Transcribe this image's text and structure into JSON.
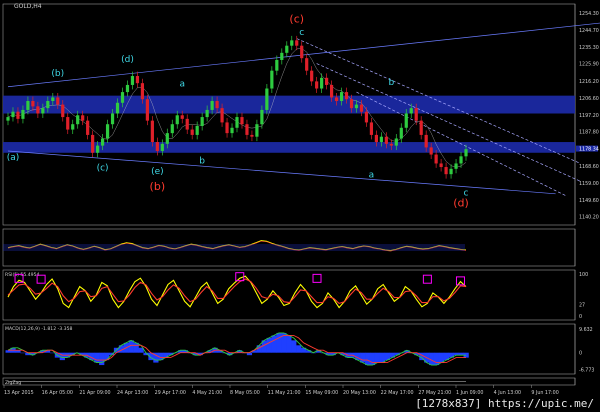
{
  "window": {
    "symbol_label": "GOLD,H4"
  },
  "footer": {
    "url": "[1278x837] https://upic.me/"
  },
  "colors": {
    "background": "#000000",
    "bull": "#2ecc40",
    "bear": "#e0202a",
    "band": "#1c2aa8",
    "rsi": "#ffff00",
    "rsi_box": "#ff00ff",
    "macd_hist": "#1f3fff",
    "wave_cyan": "#3fd8e6",
    "wave_red": "#ff3b2f",
    "wave_green": "#7dff8a",
    "grid_text": "#cfcfcf"
  },
  "chart_data": [
    {
      "type": "candlestick",
      "name_label": "GOLD,H4",
      "ylim": [
        1140,
        1256
      ],
      "y_ticks": [
        "1254.30",
        "1244.70",
        "1235.30",
        "1225.90",
        "1216.20",
        "1206.60",
        "1197.20",
        "1187.80",
        "1178.34",
        "1168.60",
        "1159.00",
        "1149.60",
        "1140.20"
      ],
      "current_price": "1178.34",
      "closes": [
        1196,
        1199,
        1195,
        1200,
        1205,
        1202,
        1198,
        1201,
        1205,
        1207,
        1203,
        1196,
        1189,
        1192,
        1197,
        1194,
        1186,
        1176,
        1180,
        1184,
        1192,
        1198,
        1204,
        1210,
        1214,
        1219,
        1215,
        1206,
        1194,
        1182,
        1177,
        1181,
        1187,
        1192,
        1197,
        1195,
        1189,
        1186,
        1191,
        1196,
        1200,
        1205,
        1201,
        1193,
        1187,
        1190,
        1196,
        1192,
        1186,
        1185,
        1192,
        1200,
        1212,
        1222,
        1228,
        1232,
        1236,
        1239,
        1236,
        1229,
        1222,
        1216,
        1212,
        1218,
        1214,
        1207,
        1205,
        1210,
        1206,
        1201,
        1203,
        1199,
        1193,
        1186,
        1182,
        1185,
        1181,
        1180,
        1184,
        1190,
        1198,
        1201,
        1194,
        1186,
        1179,
        1175,
        1170,
        1168,
        1164,
        1167,
        1170,
        1174,
        1178
      ],
      "bands": [
        [
          1198,
          1208
        ],
        [
          1176,
          1182
        ]
      ],
      "wave_labels": [
        {
          "text": "(c)",
          "color": "red",
          "i": 58,
          "price": 1249
        },
        {
          "text": "c",
          "color": "cyan",
          "i": 59,
          "price": 1242
        },
        {
          "text": "(b)",
          "color": "red",
          "i": 30,
          "price": 1155
        },
        {
          "text": "(d)",
          "color": "red",
          "i": 91,
          "price": 1146
        },
        {
          "text": "(a)",
          "color": "cyan",
          "i": 1,
          "price": 1172
        },
        {
          "text": "(b)",
          "color": "cyan",
          "i": 10,
          "price": 1219
        },
        {
          "text": "(c)",
          "color": "cyan",
          "i": 19,
          "price": 1166
        },
        {
          "text": "(d)",
          "color": "cyan",
          "i": 24,
          "price": 1227
        },
        {
          "text": "(e)",
          "color": "cyan",
          "i": 30,
          "price": 1164
        },
        {
          "text": "a",
          "color": "cyan",
          "i": 35,
          "price": 1213
        },
        {
          "text": "b",
          "color": "cyan",
          "i": 39,
          "price": 1170
        },
        {
          "text": "a",
          "color": "cyan",
          "i": 73,
          "price": 1162
        },
        {
          "text": "b",
          "color": "cyan",
          "i": 77,
          "price": 1214
        },
        {
          "text": "c",
          "color": "cyan",
          "i": 92,
          "price": 1152
        }
      ]
    },
    {
      "type": "line",
      "name_label": "",
      "ylim": [
        0,
        100
      ],
      "y_ticks": [],
      "series": [
        {
          "name": "",
          "color": "#ff3b2f",
          "values": [
            48,
            52,
            55,
            50,
            47,
            53,
            60,
            55,
            49,
            45,
            52,
            58,
            54,
            47,
            42,
            47,
            53,
            48,
            41,
            44,
            52,
            60,
            65,
            62,
            55,
            48,
            45,
            50,
            56,
            53,
            47,
            44,
            49,
            55,
            60,
            57,
            52,
            48,
            45,
            50,
            55,
            58,
            54,
            49,
            52,
            58,
            65,
            72,
            70,
            63,
            57,
            52,
            46,
            42,
            40,
            44,
            48,
            46,
            43,
            41,
            45,
            49,
            52,
            48,
            45,
            50,
            54,
            52,
            47,
            44,
            40,
            38,
            42,
            48,
            53,
            50,
            46,
            43,
            45,
            50,
            55,
            52,
            48,
            45,
            42,
            40
          ]
        },
        {
          "name": "",
          "color": "#ffff00",
          "values": [
            50,
            54,
            57,
            52,
            49,
            55,
            62,
            57,
            51,
            47,
            54,
            60,
            56,
            49,
            44,
            49,
            55,
            50,
            43,
            46,
            54,
            62,
            67,
            64,
            57,
            50,
            47,
            52,
            58,
            55,
            49,
            46,
            51,
            57,
            62,
            59,
            54,
            50,
            47,
            52,
            57,
            60,
            56,
            51,
            54,
            60,
            67,
            74,
            72,
            65,
            59,
            54,
            48,
            44,
            42,
            46,
            50,
            48,
            45,
            43,
            47,
            51,
            54,
            50,
            47,
            52,
            56,
            54,
            49,
            46,
            42,
            40,
            44,
            50,
            55,
            52,
            48,
            45,
            47,
            52,
            57,
            54,
            50,
            47,
            44,
            42
          ]
        }
      ]
    },
    {
      "type": "line",
      "name_label": "RSI(5) 55.4954",
      "ylim": [
        0,
        100
      ],
      "y_ticks": [
        "100",
        "27",
        "0"
      ],
      "series": [
        {
          "name": "",
          "color": "#ffff00",
          "values": [
            45,
            70,
            85,
            80,
            60,
            40,
            55,
            75,
            88,
            65,
            30,
            20,
            45,
            70,
            60,
            35,
            50,
            80,
            72,
            40,
            20,
            35,
            60,
            82,
            90,
            70,
            40,
            25,
            50,
            75,
            85,
            60,
            35,
            22,
            45,
            68,
            80,
            55,
            30,
            40,
            65,
            78,
            90,
            95,
            80,
            55,
            30,
            40,
            60,
            45,
            25,
            30,
            55,
            75,
            60,
            35,
            20,
            30,
            55,
            40,
            20,
            35,
            60,
            72,
            50,
            28,
            40,
            65,
            75,
            55,
            35,
            45,
            70,
            60,
            40,
            22,
            30,
            55,
            45,
            30,
            45,
            65,
            82,
            70
          ]
        },
        {
          "name": "",
          "color": "#ff3b2f",
          "values": [
            50,
            62,
            74,
            76,
            66,
            52,
            55,
            66,
            78,
            70,
            48,
            34,
            42,
            58,
            60,
            46,
            48,
            66,
            70,
            52,
            34,
            36,
            50,
            68,
            80,
            74,
            54,
            38,
            46,
            62,
            74,
            66,
            48,
            34,
            40,
            56,
            70,
            60,
            42,
            42,
            56,
            70,
            82,
            88,
            82,
            66,
            46,
            42,
            52,
            48,
            34,
            32,
            46,
            62,
            60,
            46,
            32,
            32,
            46,
            42,
            30,
            34,
            50,
            64,
            56,
            40,
            40,
            54,
            66,
            58,
            44,
            44,
            58,
            60,
            48,
            32,
            32,
            46,
            46,
            36,
            42,
            56,
            72,
            70
          ]
        }
      ]
    },
    {
      "type": "bar",
      "name_label": "MACD(12,26,9) -1.812 -3.358",
      "ylim": [
        -7,
        10
      ],
      "y_ticks": [
        "9.632",
        "0",
        "-6.773"
      ],
      "values": [
        1,
        2,
        1,
        0,
        -1,
        -1,
        0,
        1,
        1,
        0,
        -2,
        -3,
        -2,
        -1,
        0,
        -1,
        -2,
        -3,
        -4,
        -5,
        -3,
        -1,
        2,
        3,
        4,
        5,
        4,
        2,
        -1,
        -3,
        -4,
        -3,
        -2,
        -1,
        0,
        1,
        1,
        0,
        -1,
        -1,
        0,
        1,
        2,
        1,
        0,
        -1,
        0,
        1,
        0,
        -1,
        1,
        3,
        5,
        6,
        7,
        8,
        8,
        7,
        5,
        3,
        2,
        1,
        0,
        1,
        0,
        -1,
        -1,
        0,
        -1,
        -2,
        -2,
        -3,
        -4,
        -5,
        -5,
        -4,
        -4,
        -3,
        -2,
        -1,
        0,
        1,
        0,
        -1,
        -3,
        -4,
        -5,
        -5,
        -4,
        -3,
        -2,
        -1,
        -1,
        -2
      ],
      "series": [
        {
          "name": "",
          "color": "#2ecc40",
          "values": [
            1,
            2,
            2,
            1,
            0,
            -1,
            0,
            1,
            1,
            1,
            -1,
            -2,
            -2,
            -1,
            0,
            -1,
            -2,
            -3,
            -4,
            -4,
            -3,
            -1,
            1,
            3,
            4,
            5,
            4,
            3,
            0,
            -2,
            -3,
            -3,
            -2,
            -1,
            0,
            1,
            1,
            0,
            -1,
            -1,
            0,
            1,
            2,
            1,
            0,
            -1,
            0,
            1,
            0,
            0,
            1,
            3,
            5,
            6,
            7,
            8,
            8,
            7,
            6,
            4,
            2,
            1,
            0,
            1,
            0,
            -1,
            -1,
            0,
            -1,
            -2,
            -2,
            -3,
            -4,
            -5,
            -5,
            -4,
            -4,
            -3,
            -2,
            -1,
            0,
            1,
            0,
            -1,
            -2,
            -4,
            -5,
            -5,
            -4,
            -3,
            -2,
            -1,
            -1,
            -1
          ]
        },
        {
          "name": "",
          "color": "#ff3b2f",
          "values": [
            1,
            1,
            1,
            1,
            0,
            0,
            0,
            0,
            1,
            1,
            0,
            -1,
            -1,
            -1,
            -1,
            -1,
            -1,
            -2,
            -3,
            -3,
            -3,
            -2,
            0,
            1,
            2,
            3,
            3,
            3,
            2,
            0,
            -1,
            -2,
            -2,
            -2,
            -1,
            0,
            0,
            0,
            0,
            -1,
            0,
            0,
            1,
            1,
            1,
            0,
            0,
            0,
            0,
            0,
            1,
            2,
            3,
            4,
            5,
            6,
            7,
            7,
            7,
            6,
            4,
            3,
            2,
            1,
            1,
            0,
            0,
            0,
            0,
            -1,
            -1,
            -2,
            -3,
            -3,
            -4,
            -4,
            -4,
            -4,
            -3,
            -2,
            -1,
            0,
            0,
            0,
            -1,
            -2,
            -3,
            -4,
            -4,
            -4,
            -3,
            -2,
            -2,
            -2
          ]
        }
      ]
    },
    {
      "type": "line",
      "name_label": "ZigZag",
      "ylim": [
        0,
        10
      ],
      "y_ticks": [],
      "series": [
        {
          "name": "",
          "color": "#cfcfcf",
          "values": [
            5,
            5,
            5,
            5,
            5,
            5,
            5,
            5,
            5,
            5,
            5,
            5,
            5,
            5,
            5,
            5,
            5,
            5,
            5,
            5
          ]
        }
      ]
    }
  ],
  "x_axis": {
    "ticks": [
      "13 Apr 2015",
      "16 Apr 05:00",
      "21 Apr 09:00",
      "24 Apr 13:00",
      "29 Apr 17:00",
      "4 May 21:00",
      "8 May 05:00",
      "11 May 21:00",
      "15 May 09:00",
      "20 May 13:00",
      "22 May 17:00",
      "27 May 21:00",
      "1 Jun 09:00",
      "4 Jun 13:00",
      "9 Jun 17:00"
    ]
  }
}
